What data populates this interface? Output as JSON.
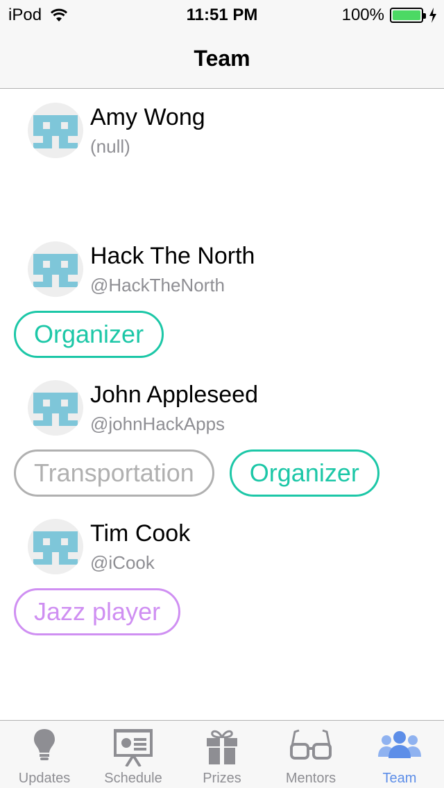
{
  "status_bar": {
    "carrier": "iPod",
    "time": "11:51 PM",
    "battery": "100%"
  },
  "nav": {
    "title": "Team"
  },
  "members": [
    {
      "name": "Amy Wong",
      "handle": "(null)",
      "tags": []
    },
    {
      "name": "Hack The North",
      "handle": "@HackTheNorth",
      "tags": [
        {
          "label": "Organizer",
          "color": "#1cc7a7"
        }
      ]
    },
    {
      "name": "John Appleseed",
      "handle": "@johnHackApps",
      "tags": [
        {
          "label": "Transportation",
          "color": "#b0b0b0"
        },
        {
          "label": "Organizer",
          "color": "#1cc7a7"
        }
      ]
    },
    {
      "name": "Tim Cook",
      "handle": "@iCook",
      "tags": [
        {
          "label": "Jazz player",
          "color": "#cf8ff2"
        }
      ]
    }
  ],
  "tabs": [
    {
      "label": "Updates",
      "icon": "lightbulb-icon",
      "active": false
    },
    {
      "label": "Schedule",
      "icon": "presentation-icon",
      "active": false
    },
    {
      "label": "Prizes",
      "icon": "gift-icon",
      "active": false
    },
    {
      "label": "Mentors",
      "icon": "glasses-icon",
      "active": false
    },
    {
      "label": "Team",
      "icon": "people-icon",
      "active": true
    }
  ],
  "colors": {
    "active_tab": "#5d8ee8",
    "inactive_tab": "#8e8e93",
    "avatar_blue": "#7ec6d9"
  }
}
